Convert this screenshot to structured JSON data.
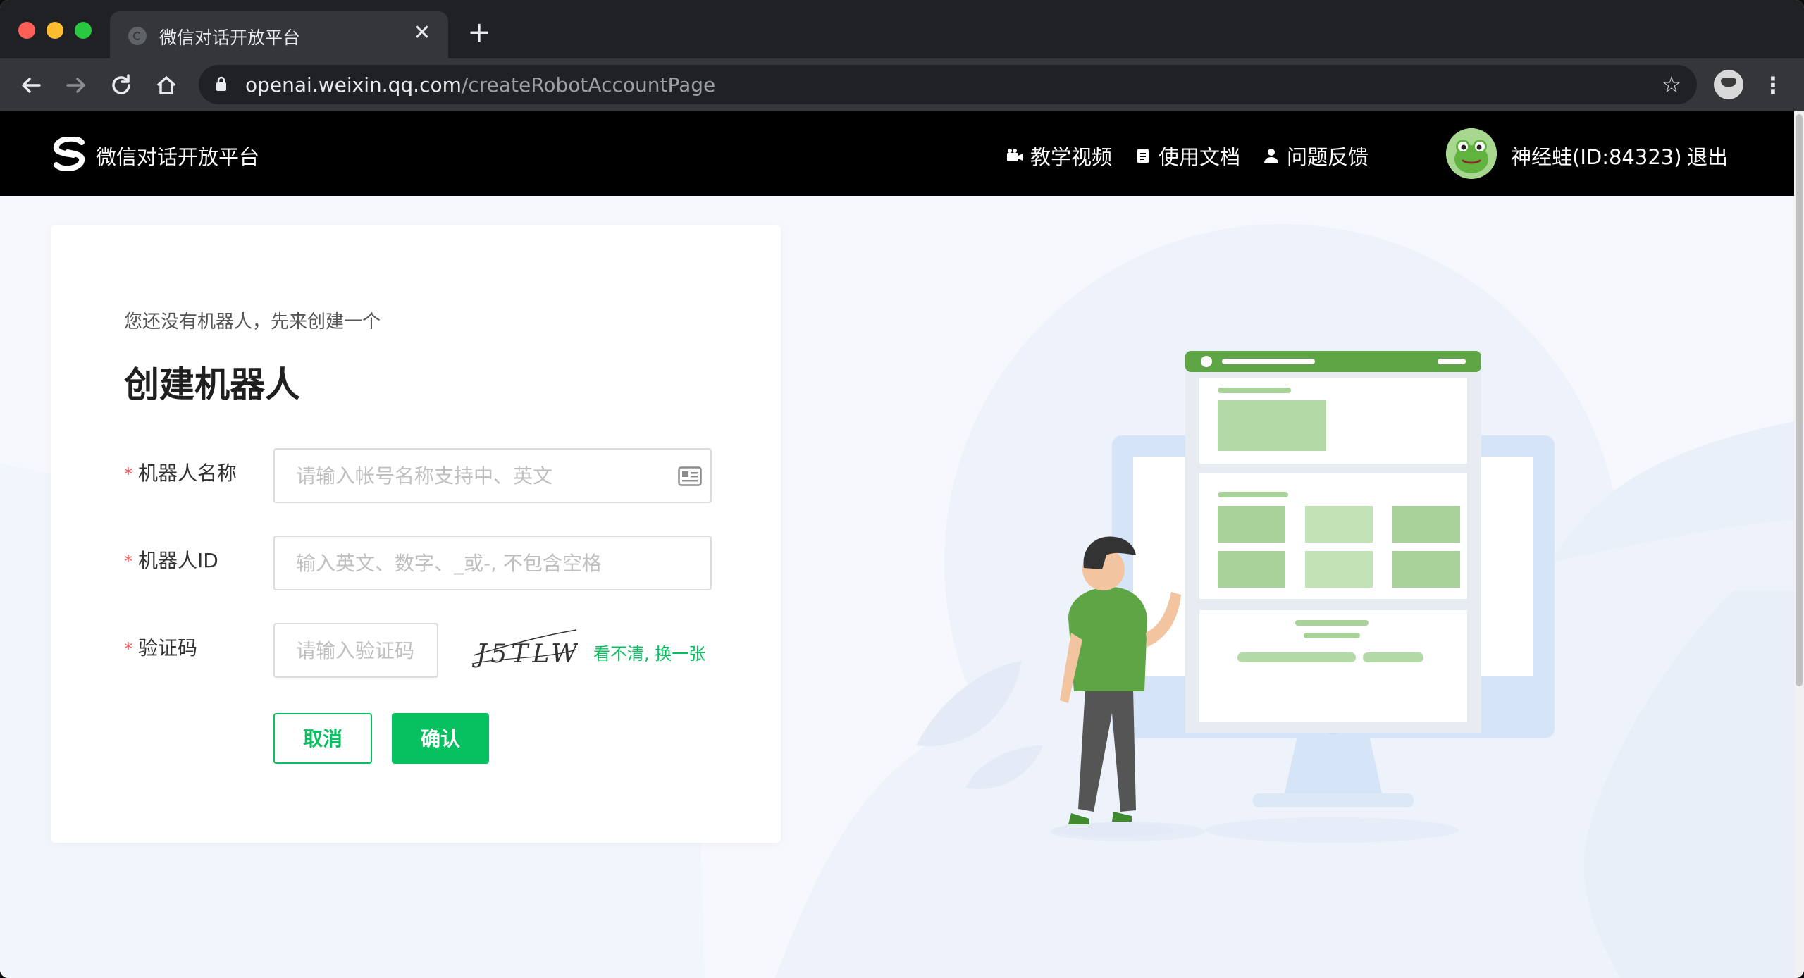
{
  "browser": {
    "tab_title": "微信对话开放平台",
    "tab_close": "✕",
    "new_tab": "+",
    "url_host": "openai.weixin.qq.com",
    "url_path": "/createRobotAccountPage",
    "icons": [
      "back-icon",
      "forward-icon",
      "reload-icon",
      "home-icon",
      "lock-icon",
      "star-icon",
      "profile-avatar",
      "menu-icon"
    ]
  },
  "header": {
    "brand": "微信对话开放平台",
    "nav": [
      {
        "label": "教学视频",
        "icon": "video-camera-icon"
      },
      {
        "label": "使用文档",
        "icon": "document-icon"
      },
      {
        "label": "问题反馈",
        "icon": "person-icon"
      }
    ],
    "username": "神经蛙(ID:84323)",
    "logout": "退出"
  },
  "form": {
    "subtitle": "您还没有机器人，先来创建一个",
    "title": "创建机器人",
    "required_mark": "*",
    "name_label": "机器人名称",
    "name_placeholder": "请输入帐号名称支持中、英文",
    "id_label": "机器人ID",
    "id_placeholder": "输入英文、数字、_或-, 不包含空格",
    "captcha_label": "验证码",
    "captcha_placeholder": "请输入验证码",
    "captcha_text": "J5TLW",
    "refresh_link": "看不清, 换一张",
    "cancel": "取消",
    "confirm": "确认"
  },
  "colors": {
    "accent": "#07c160",
    "required": "#fa5151",
    "header_bg": "#000000",
    "page_bg": "#f6f8fd"
  }
}
